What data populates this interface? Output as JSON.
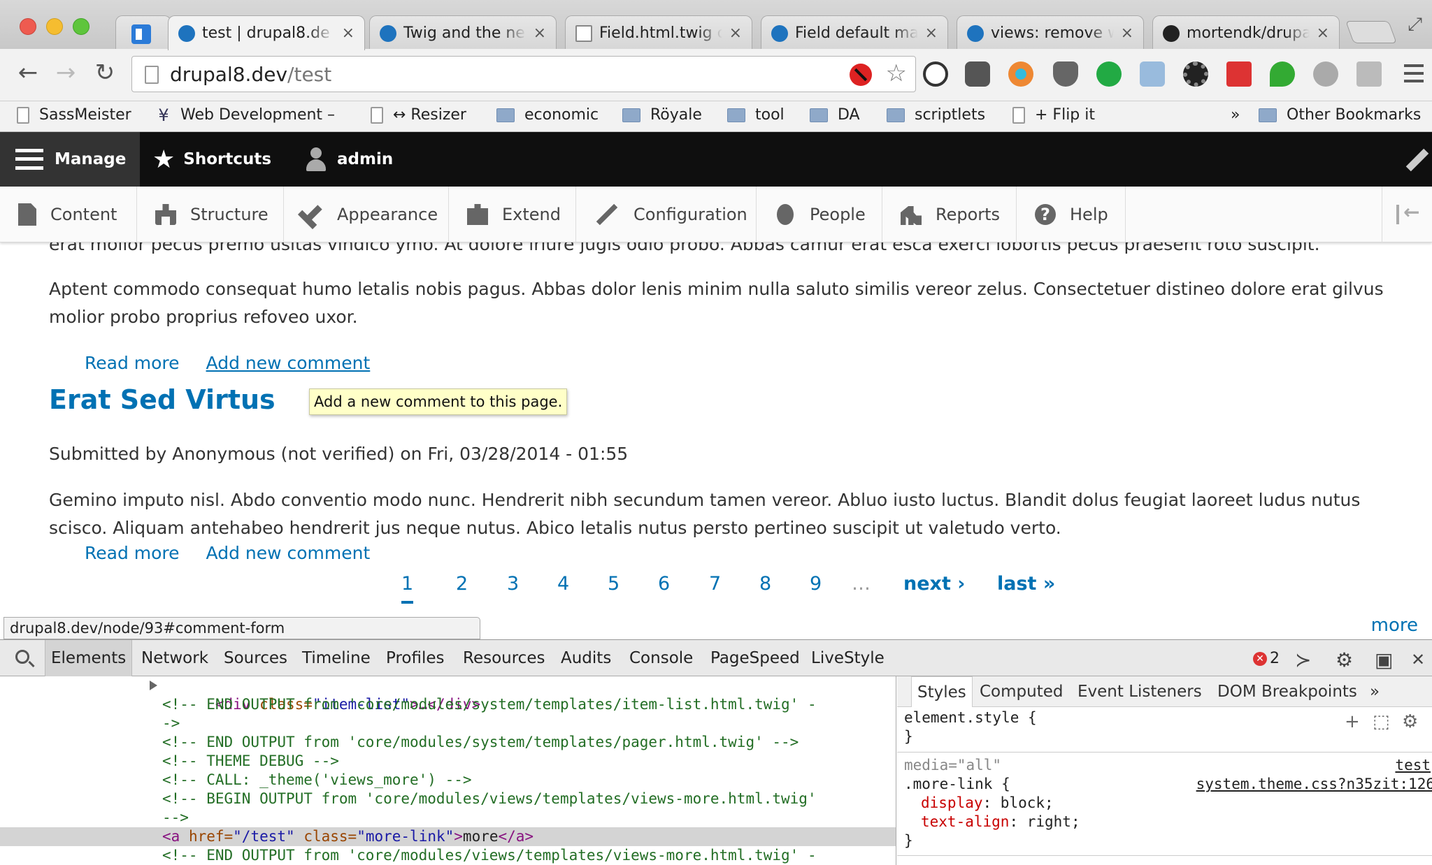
{
  "browser": {
    "tabs": [
      {
        "title": "test | drupal8.de",
        "favicon": "drupal-icon",
        "active": true
      },
      {
        "title": "Twig and the ne",
        "favicon": "drupal-icon"
      },
      {
        "title": "Field.html.twig c",
        "favicon": "document-icon"
      },
      {
        "title": "Field default ma",
        "favicon": "drupal-icon"
      },
      {
        "title": "views: remove w",
        "favicon": "drupal-icon"
      },
      {
        "title": "mortendk/drupa",
        "favicon": "github-icon"
      }
    ],
    "tab_close": "×",
    "url_host": "drupal8.dev",
    "url_path": "/test",
    "bookmarks": [
      {
        "label": "SassMeister",
        "icon": "page-icon"
      },
      {
        "label": "Web Development –",
        "icon": "dev-icon"
      },
      {
        "label": "↔ Resizer",
        "icon": "page-icon"
      },
      {
        "label": "economic",
        "icon": "folder-icon"
      },
      {
        "label": "Röyale",
        "icon": "folder-icon"
      },
      {
        "label": "tool",
        "icon": "folder-icon"
      },
      {
        "label": "DA",
        "icon": "folder-icon"
      },
      {
        "label": "scriptlets",
        "icon": "folder-icon"
      },
      {
        "label": "+ Flip it",
        "icon": "page-icon"
      }
    ],
    "bookmarks_overflow": "»",
    "other_bookmarks": "Other Bookmarks"
  },
  "drupal_toolbar": {
    "manage": "Manage",
    "shortcuts": "Shortcuts",
    "user": "admin"
  },
  "admin_menu": [
    {
      "label": "Content",
      "icon": "content-icon"
    },
    {
      "label": "Structure",
      "icon": "structure-icon"
    },
    {
      "label": "Appearance",
      "icon": "appearance-icon"
    },
    {
      "label": "Extend",
      "icon": "extend-icon"
    },
    {
      "label": "Configuration",
      "icon": "configuration-icon"
    },
    {
      "label": "People",
      "icon": "people-icon"
    },
    {
      "label": "Reports",
      "icon": "reports-icon"
    },
    {
      "label": "Help",
      "icon": "help-icon"
    }
  ],
  "content": {
    "partial_para": "erat molior pecus premo usitas vindico ymo. At dolore iriure jugis odio probo. Abbas camur erat esca exerci lobortis pecus praesent roto suscipit.",
    "para1": "Aptent commodo consequat humo letalis nobis pagus. Abbas dolor lenis minim nulla saluto similis vereor zelus. Consectetuer distineo dolore erat gilvus molior probo proprius refoveo uxor.",
    "read_more": "Read more",
    "add_comment": "Add new comment",
    "tooltip": "Add a new comment to this page.",
    "node_title": "Erat Sed Virtus",
    "submitted": "Submitted by Anonymous (not verified) on Fri, 03/28/2014 - 01:55",
    "para2": "Gemino imputo nisl. Abdo conventio modo nunc. Hendrerit nibh secundum tamen vereor. Abluo iusto luctus. Blandit dolus feugiat laoreet ludus nutus scisco. Aliquam antehabeo hendrerit jus neque nutus. Abico letalis nutus persto pertineo suscipit ut valetudo verto.",
    "pager": {
      "pages": [
        "1",
        "2",
        "3",
        "4",
        "5",
        "6",
        "7",
        "8",
        "9"
      ],
      "current": "1",
      "ellipsis": "…",
      "next": "next ›",
      "last": "last »"
    },
    "more": "more",
    "status_url": "drupal8.dev/node/93#comment-form"
  },
  "devtools": {
    "tabs": [
      "Elements",
      "Network",
      "Sources",
      "Timeline",
      "Profiles",
      "Resources",
      "Audits",
      "Console",
      "PageSpeed",
      "LiveStyle"
    ],
    "error_count": "2",
    "dom": {
      "l0_tag_open": "<div ",
      "l0_attr": "class=",
      "l0_val": "\"item-list\"",
      "l0_rest": ">…</div>",
      "l1": "<!-- END OUTPUT from 'core/modules/system/templates/item-list.html.twig' -",
      "l2": "->",
      "l3": "<!-- END OUTPUT from 'core/modules/system/templates/pager.html.twig' -->",
      "l4": "<!-- THEME DEBUG -->",
      "l5": "<!-- CALL: _theme('views_more') -->",
      "l6": "<!-- BEGIN OUTPUT from 'core/modules/views/templates/views-more.html.twig'",
      "l7": "-->",
      "sel_tag_open": "<a ",
      "sel_attr1": "href=",
      "sel_val1": "\"/test\"",
      "sel_attr2": " class=",
      "sel_val2": "\"more-link\"",
      "sel_mid": ">",
      "sel_text": "more",
      "sel_close": "</a>",
      "l9": "<!-- END OUTPUT from 'core/modules/views/templates/views-more.html.twig' -"
    },
    "styles": {
      "tabs": [
        "Styles",
        "Computed",
        "Event Listeners",
        "DOM Breakpoints"
      ],
      "overflow": "»",
      "element_style_open": "element.style {",
      "close_brace": "}",
      "media": "media=\"all\"",
      "source_top": "test",
      "source": "system.theme.css?n35zit:126",
      "selector": ".more-link {",
      "prop1": "display",
      "val1": ": block;",
      "prop2": "text-align",
      "val2": ": right;"
    }
  }
}
